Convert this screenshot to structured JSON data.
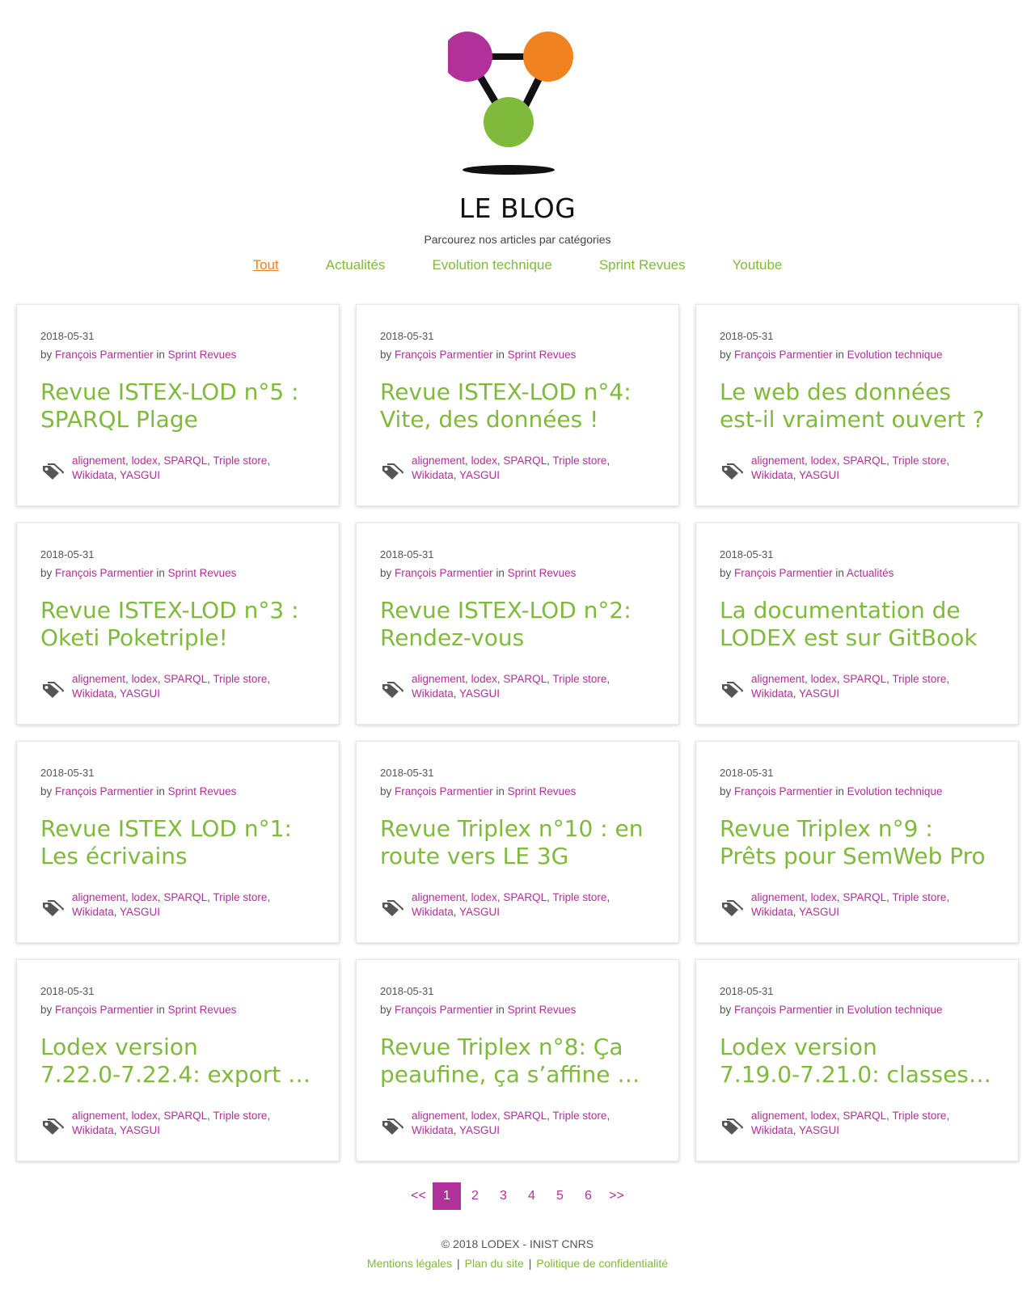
{
  "header": {
    "title": "LE BLOG",
    "subtitle": "Parcourez nos articles par catégories"
  },
  "nav": {
    "items": [
      {
        "label": "Tout",
        "active": true
      },
      {
        "label": "Actualités"
      },
      {
        "label": "Evolution technique"
      },
      {
        "label": "Sprint Revues"
      },
      {
        "label": "Youtube"
      }
    ]
  },
  "meta_labels": {
    "by": "by",
    "in": "in"
  },
  "posts": [
    {
      "date": "2018-05-31",
      "author": "François Parmentier",
      "category": "Sprint Revues",
      "title_line1": "Revue ISTEX-LOD n°5 :",
      "title_line2": "SPARQL Plage"
    },
    {
      "date": "2018-05-31",
      "author": "François Parmentier",
      "category": "Sprint Revues",
      "title_line1": "Revue ISTEX-LOD n°4:",
      "title_line2": "Vite, des données !"
    },
    {
      "date": "2018-05-31",
      "author": "François Parmentier",
      "category": "Evolution technique",
      "title_line1": "Le web des données",
      "title_line2": "est-il vraiment ouvert ?"
    },
    {
      "date": "2018-05-31",
      "author": "François Parmentier",
      "category": "Sprint Revues",
      "title_line1": "Revue ISTEX-LOD n°3 :",
      "title_line2": "Oketi Poketriple!"
    },
    {
      "date": "2018-05-31",
      "author": "François Parmentier",
      "category": "Sprint Revues",
      "title_line1": "Revue ISTEX-LOD n°2:",
      "title_line2": "Rendez-vous"
    },
    {
      "date": "2018-05-31",
      "author": "François Parmentier",
      "category": "Actualités",
      "title_line1": "La documentation de",
      "title_line2": "LODEX est sur GitBook"
    },
    {
      "date": "2018-05-31",
      "author": "François Parmentier",
      "category": "Sprint Revues",
      "title_line1": "Revue ISTEX LOD n°1:",
      "title_line2": "Les écrivains"
    },
    {
      "date": "2018-05-31",
      "author": "François Parmentier",
      "category": "Sprint Revues",
      "title_line1": "Revue Triplex n°10 : en",
      "title_line2": "route vers LE 3G"
    },
    {
      "date": "2018-05-31",
      "author": "François Parmentier",
      "category": "Evolution technique",
      "title_line1": "Revue Triplex n°9 :",
      "title_line2": "Prêts pour SemWeb Pro"
    },
    {
      "date": "2018-05-31",
      "author": "François Parmentier",
      "category": "Sprint Revues",
      "title_line1": "Lodex version",
      "title_line2": "7.22.0-7.22.4: export …"
    },
    {
      "date": "2018-05-31",
      "author": "François Parmentier",
      "category": "Sprint Revues",
      "title_line1": "Revue Triplex n°8: Ça",
      "title_line2": "peaufine, ça s’affine …"
    },
    {
      "date": "2018-05-31",
      "author": "François Parmentier",
      "category": "Evolution technique",
      "title_line1": "Lodex version",
      "title_line2": "7.19.0-7.21.0: classes …"
    }
  ],
  "tags": [
    "alignement",
    "lodex",
    "SPARQL",
    "Triple store",
    "Wikidata",
    "YASGUI"
  ],
  "pagination": {
    "prev": "<<",
    "pages": [
      "1",
      "2",
      "3",
      "4",
      "5",
      "6"
    ],
    "current": "1",
    "next": ">>"
  },
  "footer": {
    "copyright": "© 2018 LODEX - INIST CNRS",
    "links": [
      "Mentions légales",
      "Plan du site",
      "Politique de confidentialité"
    ],
    "separator": "|"
  },
  "colors": {
    "green": "#7fba3c",
    "purple": "#b0319a",
    "orange": "#f0821f"
  }
}
